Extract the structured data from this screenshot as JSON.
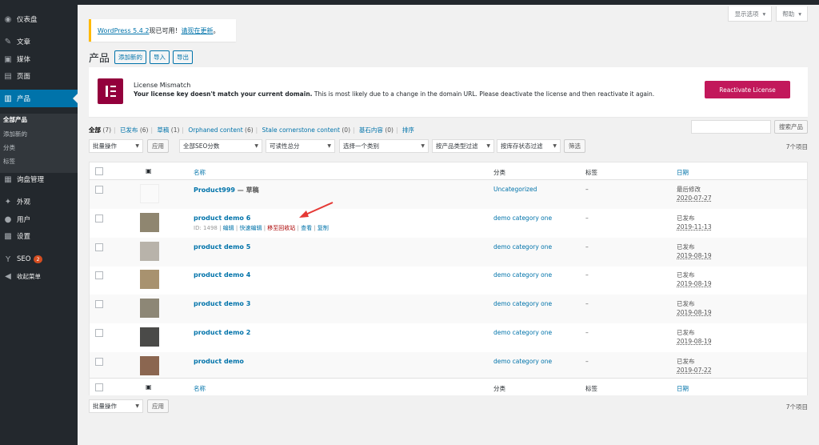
{
  "sidebar": {
    "items": [
      {
        "icon": "dashboard-icon",
        "glyph": "◉",
        "label": "仪表盘"
      },
      {
        "icon": "pin-icon",
        "glyph": "✎",
        "label": "文章"
      },
      {
        "icon": "media-icon",
        "glyph": "▣",
        "label": "媒体"
      },
      {
        "icon": "page-icon",
        "glyph": "▤",
        "label": "页面"
      },
      {
        "icon": "products-icon",
        "glyph": "▥",
        "label": "产品"
      },
      {
        "icon": "inquiry-icon",
        "glyph": "▦",
        "label": "询盘管理"
      },
      {
        "icon": "appearance-icon",
        "glyph": "✦",
        "label": "外观"
      },
      {
        "icon": "users-icon",
        "glyph": "●",
        "label": "用户"
      },
      {
        "icon": "settings-icon",
        "glyph": "▩",
        "label": "设置"
      },
      {
        "icon": "seo-icon",
        "glyph": "Y",
        "label": "SEO",
        "badge": "2"
      },
      {
        "icon": "collapse-icon",
        "glyph": "◀",
        "label": "收起菜单"
      }
    ],
    "submenu": [
      "全部产品",
      "添加新的",
      "分类",
      "标签"
    ]
  },
  "screen_meta": {
    "options": "显示选项",
    "help": "帮助"
  },
  "update_nag": {
    "version_link": "WordPress 5.4.2",
    "text": "现已可用！",
    "update_link": "请现在更新",
    "end": "。"
  },
  "page": {
    "title": "产品",
    "actions": [
      "添加新的",
      "导入",
      "导出"
    ]
  },
  "license": {
    "title": "License Mismatch",
    "bold": "Your license key doesn't match your current domain.",
    "message": " This is most likely due to a change in the domain URL. Please deactivate the license and then reactivate it again.",
    "button": "Reactivate License"
  },
  "views": [
    {
      "label": "全部",
      "count": "(7)"
    },
    {
      "label": "已发布",
      "count": "(6)"
    },
    {
      "label": "草稿",
      "count": "(1)"
    },
    {
      "label": "Orphaned content",
      "count": "(6)"
    },
    {
      "label": "Stale cornerstone content",
      "count": "(0)"
    },
    {
      "label": "基石内容",
      "count": "(0)"
    },
    {
      "label": "排序",
      "count": ""
    }
  ],
  "search": {
    "button": "搜索产品"
  },
  "filters": {
    "bulk": "批量操作",
    "apply": "应用",
    "seo": "全部SEO分数",
    "readability": "可读性总分",
    "category": "选择一个类别",
    "type": "按产品类型过滤",
    "stock": "按库存状态过滤",
    "filter": "筛选",
    "count": "7个项目"
  },
  "table": {
    "columns": {
      "name": "名称",
      "category": "分类",
      "tags": "标签",
      "date": "日期"
    },
    "rows": [
      {
        "name": "Product999",
        "state": " — 草稿",
        "category": "Uncategorized",
        "tags": "–",
        "status": "最后修改",
        "date": "2020-07-27",
        "thumb": "placeholder"
      },
      {
        "name": "product demo 6",
        "category": "demo category one",
        "tags": "–",
        "status": "已发布",
        "date": "2019-11-13",
        "thumb": "#8f8670",
        "actions": {
          "id": "ID: 1498",
          "edit": "编辑",
          "quick": "快速编辑",
          "trash": "移至回收站",
          "view": "查看",
          "copy": "复制"
        }
      },
      {
        "name": "product demo 5",
        "category": "demo category one",
        "tags": "–",
        "status": "已发布",
        "date": "2019-08-19",
        "thumb": "#b8b3aa"
      },
      {
        "name": "product demo 4",
        "category": "demo category one",
        "tags": "–",
        "status": "已发布",
        "date": "2019-08-19",
        "thumb": "#a8926f"
      },
      {
        "name": "product demo 3",
        "category": "demo category one",
        "tags": "–",
        "status": "已发布",
        "date": "2019-08-19",
        "thumb": "#8d8776"
      },
      {
        "name": "product demo 2",
        "category": "demo category one",
        "tags": "–",
        "status": "已发布",
        "date": "2019-08-19",
        "thumb": "#4a4a48"
      },
      {
        "name": "product demo",
        "category": "demo category one",
        "tags": "–",
        "status": "已发布",
        "date": "2019-07-22",
        "thumb": "#8b6650"
      }
    ]
  },
  "colors": {
    "accent": "#0073aa",
    "sidebar": "#23282d",
    "license_button": "#c2185b",
    "trash": "#aa0000",
    "arrow": "#e53935"
  }
}
